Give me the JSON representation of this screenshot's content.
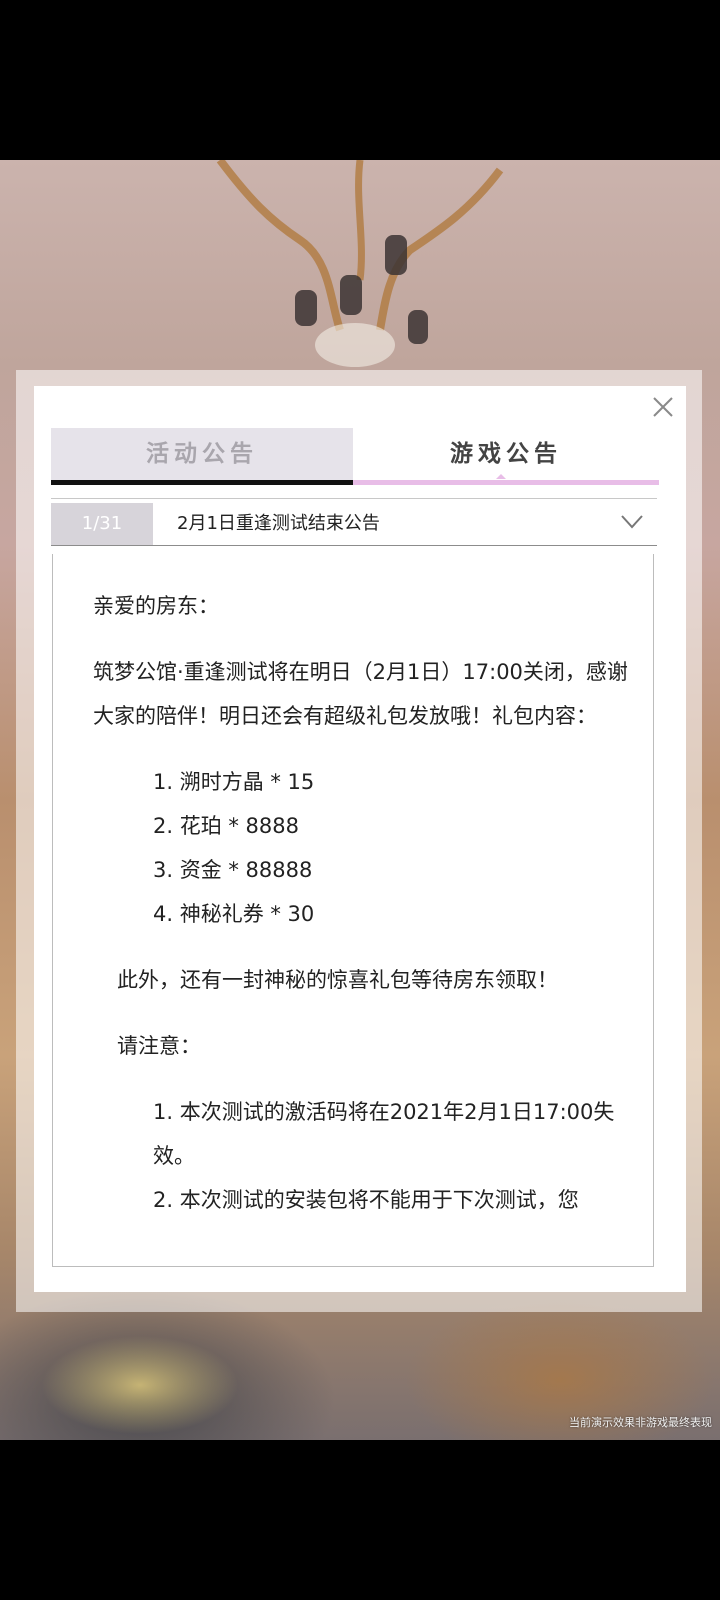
{
  "footnote": "当前演示效果非游戏最终表现",
  "tabs": [
    {
      "label": "活动公告",
      "active": false
    },
    {
      "label": "游戏公告",
      "active": true
    }
  ],
  "notice": {
    "page": "1/31",
    "title": "2月1日重逢测试结束公告"
  },
  "content": {
    "greeting": "亲爱的房东：",
    "intro": "筑梦公馆·重逢测试将在明日（2月1日）17:00关闭，感谢大家的陪伴！明日还会有超级礼包发放哦！礼包内容：",
    "gift_items": [
      "1. 溯时方晶 * 15",
      "2. 花珀 * 8888",
      "3. 资金 * 88888",
      "4. 神秘礼券 * 30"
    ],
    "extra": "此外，还有一封神秘的惊喜礼包等待房东领取！",
    "attention": "请注意：",
    "notes": [
      "1. 本次测试的激活码将在2021年2月1日17:00失效。",
      "2. 本次测试的安装包将不能用于下次测试，您"
    ]
  },
  "icons": {
    "close": "close-icon",
    "dropdown": "chevron-down-icon"
  },
  "colors": {
    "active_tab_underline": "#e8bde7",
    "inactive_tab_bg": "#e6e3ea",
    "page_badge_bg": "#d7d4da"
  }
}
